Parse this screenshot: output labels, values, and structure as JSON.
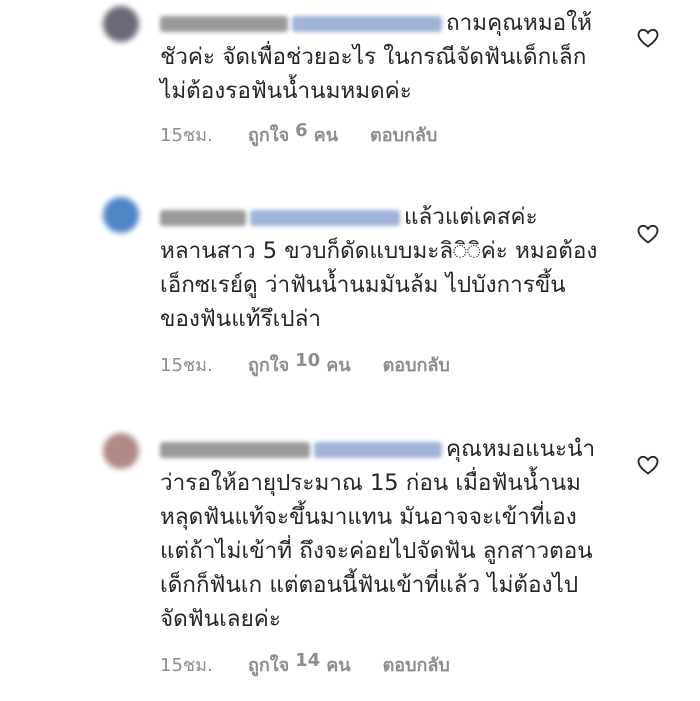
{
  "comments": [
    {
      "text": "ถามคุณหมอให้ชัวค่ะ จัดเพื่อช่วยอะไร ในกรณีจัดฟันเด็กเล็ก ไม่ต้องรอฟันน้ำนมหมดค่ะ",
      "time": "15ชม.",
      "likes_prefix": "ถูกใจ",
      "likes_count": "6",
      "likes_suffix": "คน",
      "reply": "ตอบกลับ",
      "avatar_color": "#6b6a78"
    },
    {
      "text": "แล้วแต่เคสค่ะ หลานสาว 5 ขวบก็ดัดแบบมะลิ◌ิ◌ิค่ะ หมอต้องเอ็กซเรย์ดู ว่าฟันน้ำนมมันล้ม ไปบังการขึ้นของฟันแท้รึเปล่า",
      "time": "15ชม.",
      "likes_prefix": "ถูกใจ",
      "likes_count": "10",
      "likes_suffix": "คน",
      "reply": "ตอบกลับ",
      "avatar_color": "#4f86c6"
    },
    {
      "text": "คุณหมอแนะนำว่ารอให้อายุประมาณ 15 ก่อน เมื่อฟันน้ำนมหลุดฟันแท้จะขึ้นมาแทน มันอาจจะเข้าที่เอง แต่ถ้าไม่เข้าที่ ถึงจะค่อยไปจัดฟัน ลูกสาวตอนเด็กก็ฟันเก แต่ตอนนี้ฟันเข้าที่แล้ว ไม่ต้องไปจัดฟันเลยค่ะ",
      "time": "15ชม.",
      "likes_prefix": "ถูกใจ",
      "likes_count": "14",
      "likes_suffix": "คน",
      "reply": "ตอบกลับ",
      "avatar_color": "#b08a86"
    }
  ],
  "colors": {
    "text": "#262626",
    "meta": "#8e8e8e",
    "heart": "#262626"
  },
  "icons": {
    "like": "heart-outline-icon"
  }
}
